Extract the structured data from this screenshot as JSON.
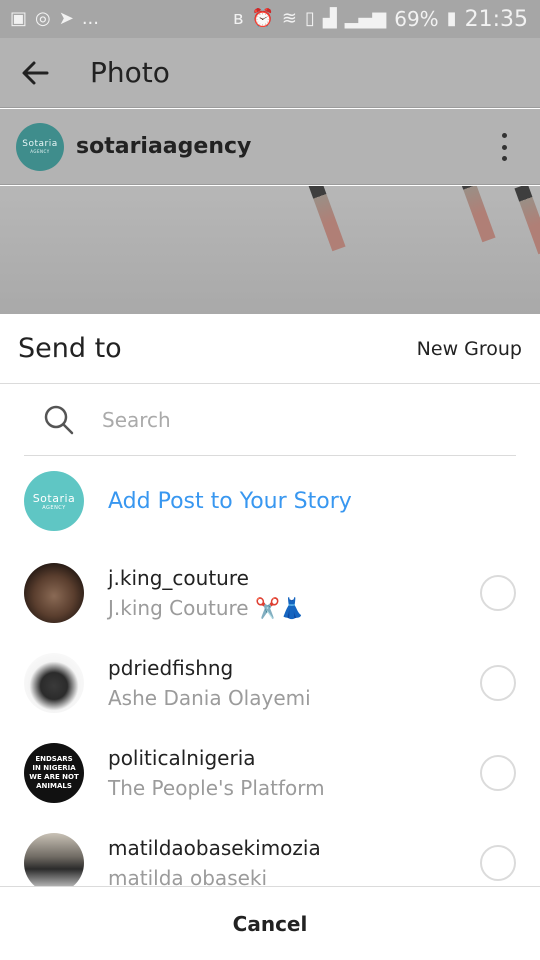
{
  "status_bar": {
    "battery": "69%",
    "time": "21:35",
    "more_indicator": "..."
  },
  "app_header": {
    "title": "Photo"
  },
  "post": {
    "username": "sotariaagency",
    "avatar_text": "Sotaria",
    "avatar_subtext": "AGENCY"
  },
  "sheet": {
    "title": "Send to",
    "new_group_label": "New Group",
    "search_placeholder": "Search",
    "story": {
      "label": "Add Post to Your Story",
      "avatar_text": "Sotaria",
      "avatar_subtext": "AGENCY"
    },
    "contacts": [
      {
        "username": "j.king_couture",
        "full_name": "J.king Couture ✂️👗"
      },
      {
        "username": "pdriedfishng",
        "full_name": "Ashe Dania Olayemi"
      },
      {
        "username": "politicalnigeria",
        "full_name": "The People's Platform",
        "avatar_lines": [
          "ENDSARS",
          "IN NIGERIA",
          "WE ARE NOT",
          "ANIMALS"
        ]
      },
      {
        "username": "matildaobasekimozia",
        "full_name": "matilda obaseki"
      }
    ],
    "cancel_label": "Cancel"
  },
  "colors": {
    "accent_blue": "#3897f0",
    "teal_avatar": "#5fc6c4",
    "divider": "#dbdbdb",
    "dim_overlay": "#a6a6a6"
  }
}
